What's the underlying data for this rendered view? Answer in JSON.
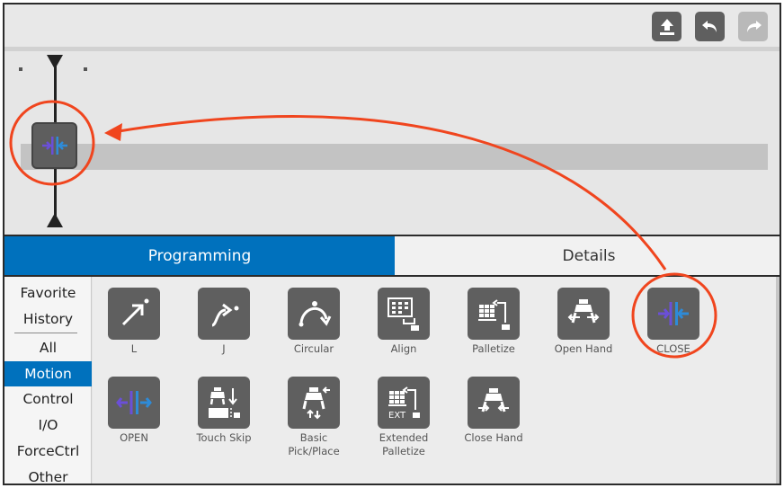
{
  "toolbar": {
    "buttons": [
      {
        "icon": "upload-icon",
        "enabled": true
      },
      {
        "icon": "undo-icon",
        "enabled": true
      },
      {
        "icon": "redo-icon",
        "enabled": false
      }
    ]
  },
  "tabs": [
    {
      "label": "Programming",
      "active": true
    },
    {
      "label": "Details",
      "active": false
    }
  ],
  "categories": [
    {
      "label": "Favorite",
      "active": false
    },
    {
      "label": "History",
      "active": false
    },
    {
      "label": "All",
      "active": false
    },
    {
      "label": "Motion",
      "active": true
    },
    {
      "label": "Control",
      "active": false
    },
    {
      "label": "I/O",
      "active": false
    },
    {
      "label": "ForceCtrl",
      "active": false
    },
    {
      "label": "Other",
      "active": false
    }
  ],
  "commands": [
    {
      "label": "L",
      "icon": "linear-move-icon"
    },
    {
      "label": "J",
      "icon": "joint-move-icon"
    },
    {
      "label": "Circular",
      "icon": "circular-move-icon"
    },
    {
      "label": "Align",
      "icon": "align-icon"
    },
    {
      "label": "Palletize",
      "icon": "palletize-icon"
    },
    {
      "label": "Open Hand",
      "icon": "open-hand-icon"
    },
    {
      "label": "CLOSE",
      "icon": "close-gripper-icon"
    },
    {
      "label": "OPEN",
      "icon": "open-gripper-icon"
    },
    {
      "label": "Touch Skip",
      "icon": "touch-skip-icon"
    },
    {
      "label": "Basic\nPick/Place",
      "icon": "basic-pick-place-icon"
    },
    {
      "label": "Extended\nPalletize",
      "icon": "extended-palletize-icon",
      "badge": "EXT"
    },
    {
      "label": "Close Hand",
      "icon": "close-hand-icon"
    }
  ],
  "timeline": {
    "block_icon": "close-gripper-icon"
  },
  "colors": {
    "accent": "#0071bd",
    "icon_bg": "#5f5f5f",
    "annotation": "#f0451e",
    "gripper_blue": "#2e8bd8",
    "gripper_purple": "#6b4fd8"
  }
}
